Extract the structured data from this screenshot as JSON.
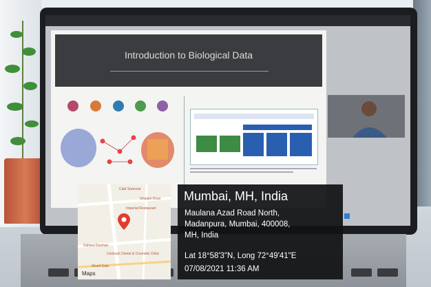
{
  "slide": {
    "title": "Introduction to Biological Data"
  },
  "overlay": {
    "city": "Mumbai, MH, India",
    "address_lines": [
      "Maulana Azad Road North,",
      "Madanpura, Mumbai, 400008,",
      "MH, India"
    ],
    "coordinates": "Lat 18°58'3\"N, Long 72°49'41\"E",
    "timestamp": "07/08/2021 11:36 AM",
    "maps_label": "Maps"
  },
  "map": {
    "labels": [
      "Cafe Samovar",
      "Ghulam Khan",
      "Imperial Restaurant",
      "Sahara Darshan",
      "Conhack Dental & Cosmetic Clinic",
      "Sharif Gate"
    ]
  },
  "icons": [
    "map-pin-icon",
    "apple-icon"
  ],
  "colors": {
    "overlay_bg": "#111214",
    "pin": "#e23b2e",
    "map_bg": "#f2efe6"
  }
}
